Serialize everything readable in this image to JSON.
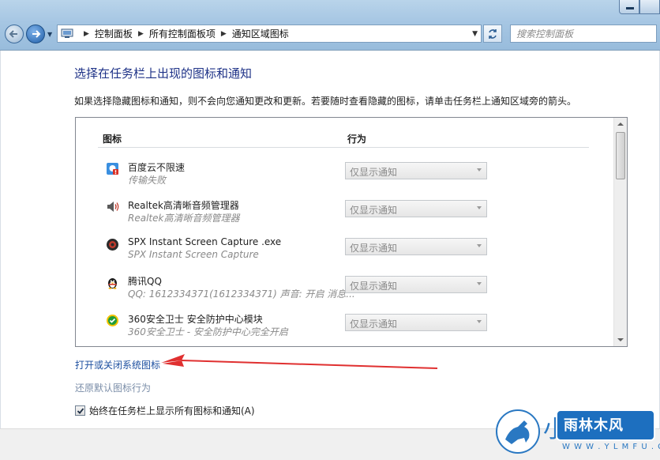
{
  "address_bar": {
    "breadcrumbs": [
      "控制面板",
      "所有控制面板项",
      "通知区域图标"
    ],
    "search_placeholder": "搜索控制面板"
  },
  "page": {
    "title": "选择在任务栏上出现的图标和通知",
    "description": "如果选择隐藏图标和通知，则不会向您通知更改和更新。若要随时查看隐藏的图标，请单击任务栏上通知区域旁的箭头。"
  },
  "table": {
    "col_icon": "图标",
    "col_behavior": "行为",
    "rows": [
      {
        "name": "百度云不限速",
        "desc": "传输失败",
        "behavior": "仅显示通知",
        "icon": "baidu-cloud-icon"
      },
      {
        "name": "Realtek高清晰音频管理器",
        "desc": "Realtek高清晰音频管理器",
        "behavior": "仅显示通知",
        "icon": "speaker-icon"
      },
      {
        "name": "SPX Instant Screen Capture .exe",
        "desc": "SPX Instant Screen Capture",
        "behavior": "仅显示通知",
        "icon": "screen-capture-icon"
      },
      {
        "name": "腾讯QQ",
        "desc": "QQ: 1612334371(1612334371)  声音: 开启  消息...",
        "behavior": "仅显示通知",
        "icon": "qq-penguin-icon"
      },
      {
        "name": "360安全卫士 安全防护中心模块",
        "desc": "360安全卫士 - 安全防护中心完全开启",
        "behavior": "仅显示通知",
        "icon": "360-shield-icon"
      }
    ]
  },
  "links": {
    "toggle_system_icons": "打开或关闭系统图标",
    "restore_defaults": "还原默认图标行为"
  },
  "always_show": {
    "label": "始终在任务栏上显示所有图标和通知(A)",
    "checked": true
  },
  "watermark": {
    "char": "小",
    "title": "雨林木风",
    "url": "W W W . Y L M F U . C O M"
  },
  "colors": {
    "title_blue": "#1e3287",
    "link_blue": "#1e50a0",
    "annotation_red": "#e03030"
  }
}
